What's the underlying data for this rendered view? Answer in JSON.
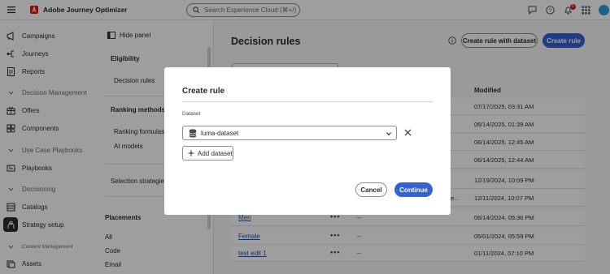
{
  "app": {
    "title": "Adobe Journey Optimizer",
    "search_placeholder": "Search Experience Cloud (⌘+/)",
    "notification_count": "5"
  },
  "leftnav": {
    "items": [
      {
        "label": "Campaigns",
        "icon": "campaigns-icon"
      },
      {
        "label": "Journeys",
        "icon": "journeys-icon"
      },
      {
        "label": "Reports",
        "icon": "reports-icon"
      },
      {
        "label": "Decision Management",
        "section": true
      },
      {
        "label": "Offers",
        "icon": "offers-icon"
      },
      {
        "label": "Components",
        "icon": "components-icon"
      },
      {
        "label": "Use Case Playbooks",
        "section": true
      },
      {
        "label": "Playbooks",
        "icon": "playbooks-icon"
      },
      {
        "label": "Decisioning",
        "section": true
      },
      {
        "label": "Catalogs",
        "icon": "catalogs-icon"
      },
      {
        "label": "Strategy setup",
        "icon": "strategy-setup-icon",
        "selected": true
      },
      {
        "label": "Content Management",
        "section": true
      },
      {
        "label": "Assets",
        "icon": "assets-icon"
      }
    ]
  },
  "panel": {
    "hide_label": "Hide panel",
    "eligibility_heading": "Eligibility",
    "decision_rules": "Decision rules",
    "ranking_heading": "Ranking methods",
    "ranking_formulas": "Ranking formulas",
    "ai_models": "AI models",
    "selection_strategies": "Selection strategies",
    "placements_heading": "Placements",
    "placements": [
      "All",
      "Code",
      "Email"
    ]
  },
  "main": {
    "title": "Decision rules",
    "create_with_dataset": "Create rule with dataset",
    "create_rule": "Create rule",
    "modified_header": "Modified",
    "rows": [
      {
        "name": "",
        "modified": "07/17/2025, 03:31 AM"
      },
      {
        "name": "",
        "modified": "06/14/2025, 01:39 AM"
      },
      {
        "name": "",
        "modified": "06/14/2025, 12:45 AM"
      },
      {
        "name": "",
        "modified": "06/14/2025, 12:44 AM"
      },
      {
        "name": "",
        "modified": "12/19/2024, 10:09 PM"
      },
      {
        "name": "",
        "trunc": "e...",
        "modified": "12/11/2024, 10:07 PM"
      },
      {
        "name": "Men",
        "dash": "–",
        "modified": "06/14/2024, 05:36 PM"
      },
      {
        "name": "Female",
        "dash": "–",
        "modified": "05/01/2024, 05:59 PM"
      },
      {
        "name": "test edit 1",
        "dash": "–",
        "modified": "01/11/2024, 07:10 PM"
      }
    ]
  },
  "modal": {
    "title": "Create rule",
    "dataset_label": "Dataset",
    "dataset_value": "luma-dataset",
    "add_dataset": "Add dataset",
    "cancel": "Cancel",
    "continue": "Continue"
  },
  "colors": {
    "accent": "#3562d4",
    "link": "#1b4fc4",
    "overlay": "rgba(0,0,0,0.38)",
    "badge": "#d31510"
  }
}
